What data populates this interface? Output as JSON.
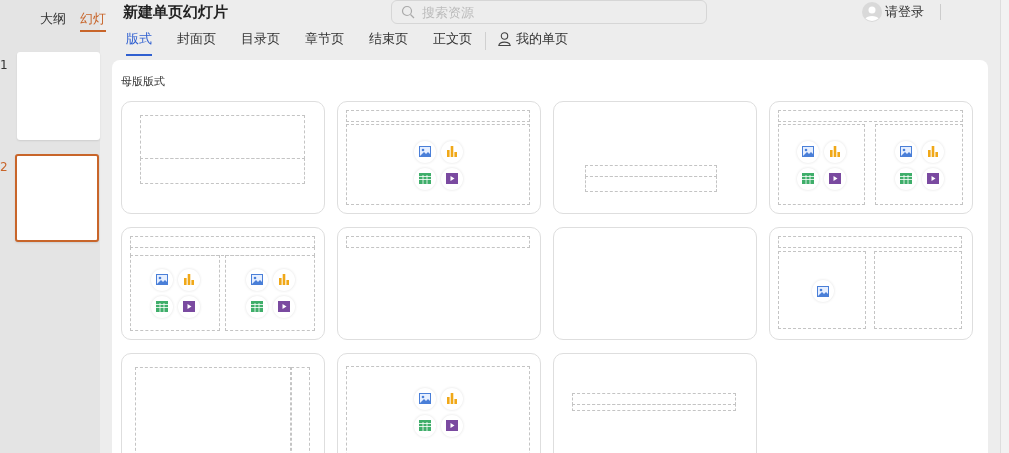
{
  "left_panel": {
    "tabs": [
      {
        "label": "大纲",
        "selected": false
      },
      {
        "label": "幻灯",
        "selected": true
      }
    ],
    "slides": [
      {
        "number": "1",
        "selected": false
      },
      {
        "number": "2",
        "selected": true
      }
    ]
  },
  "dialog": {
    "title": "新建单页幻灯片",
    "search": {
      "placeholder": "搜索资源"
    },
    "login": "请登录",
    "tabs": [
      {
        "label": "版式",
        "selected": true,
        "kind": "plain"
      },
      {
        "label": "封面页",
        "selected": false,
        "kind": "plain"
      },
      {
        "label": "目录页",
        "selected": false,
        "kind": "plain"
      },
      {
        "label": "章节页",
        "selected": false,
        "kind": "plain"
      },
      {
        "label": "结束页",
        "selected": false,
        "kind": "plain"
      },
      {
        "label": "正文页",
        "selected": false,
        "kind": "plain"
      },
      {
        "label": "我的单页",
        "selected": false,
        "kind": "user"
      }
    ],
    "section_title": "母版版式",
    "layouts": [
      {
        "kind": "title"
      },
      {
        "kind": "title-content"
      },
      {
        "kind": "section"
      },
      {
        "kind": "two-content"
      },
      {
        "kind": "comparison"
      },
      {
        "kind": "title-only"
      },
      {
        "kind": "blank"
      },
      {
        "kind": "picture-content"
      },
      {
        "kind": "vertical"
      },
      {
        "kind": "content"
      },
      {
        "kind": "caption"
      }
    ]
  }
}
